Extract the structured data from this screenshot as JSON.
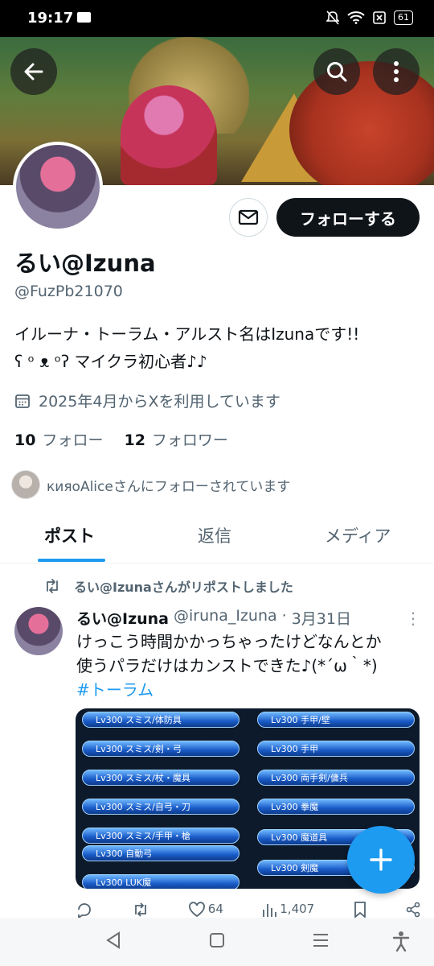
{
  "status_bar": {
    "time": "19:17",
    "battery": "61"
  },
  "header": {
    "back_icon": "arrow-left-icon",
    "search_icon": "search-icon",
    "more_icon": "more-vertical-icon"
  },
  "profile": {
    "display_name": "るい@Izuna",
    "handle": "@FuzPb21070",
    "bio_line1": "イルーナ・トーラム・アルスト名はIzunaです!!",
    "bio_line2": "ʕ ᵒ ᴥ ᵒʔ マイクラ初心者♪♪",
    "joined": "2025年4月からXを利用しています",
    "following_count": "10",
    "following_label": "フォロー",
    "followers_count": "12",
    "followers_label": "フォロワー",
    "followed_by": "кияoAliceさんにフォローされています",
    "follow_button": "フォローする"
  },
  "tabs": [
    {
      "label": "ポスト",
      "active": true
    },
    {
      "label": "返信",
      "active": false
    },
    {
      "label": "メディア",
      "active": false
    }
  ],
  "post": {
    "repost_notice": "るい@Izunaさんがリポストしました",
    "author_name": "るい@Izuna",
    "author_handle": "@iruna_Izuna",
    "date": "3月31日",
    "text_line1": "けっこう時間かかっちゃったけどなんとか",
    "text_line2": "使うパラだけはカンストできた♪(*´ω｀*)",
    "hashtag": "#トーラム",
    "media_skills_left": [
      "Lv300 スミス/体防具",
      "Lv300 スミス/剣・弓",
      "Lv300 スミス/杖・魔具",
      "Lv300 スミス/自弓・刀",
      "Lv300 スミス/手甲・槍",
      "Lv300 自動弓",
      "Lv300 LUK魔"
    ],
    "media_skills_right": [
      "Lv300 手甲/壁",
      "Lv300 手甲",
      "Lv300 両手剣/傭兵",
      "Lv300 拳魔",
      "Lv300 魔道具",
      "Lv300 剣魔"
    ],
    "likes": "64",
    "views": "1,407"
  },
  "colors": {
    "accent": "#1d9bf0",
    "text": "#0f1419",
    "secondary": "#536471"
  }
}
